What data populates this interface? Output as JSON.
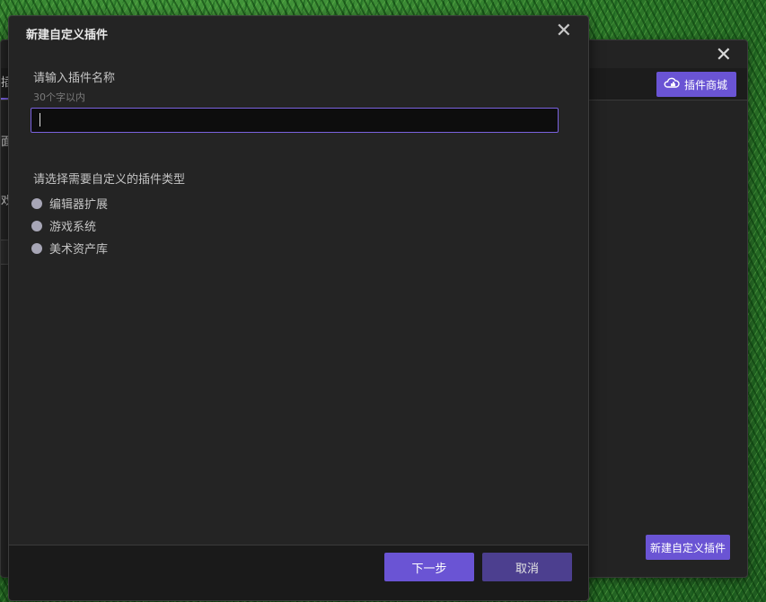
{
  "background_window": {
    "close_glyph": "✕",
    "tab_fragment": "插",
    "store_button_label": "插件商城",
    "store_icon": "puzzle-cloud-icon",
    "fragment_1": "面",
    "fragment_2": "戏",
    "new_custom_button_label": "新建自定义插件"
  },
  "dialog": {
    "title": "新建自定义插件",
    "close_glyph": "✕",
    "name_label": "请输入插件名称",
    "name_hint": "30个字以内",
    "name_value": "",
    "type_label": "请选择需要自定义的插件类型",
    "type_options": [
      "编辑器扩展",
      "游戏系统",
      "美术资产库"
    ],
    "next_button_label": "下一步",
    "cancel_button_label": "取消"
  },
  "colors": {
    "accent": "#6a54d4",
    "accent_dark": "#4c3f8f",
    "dialog_bg": "#242424",
    "input_border": "#7a62e0"
  }
}
